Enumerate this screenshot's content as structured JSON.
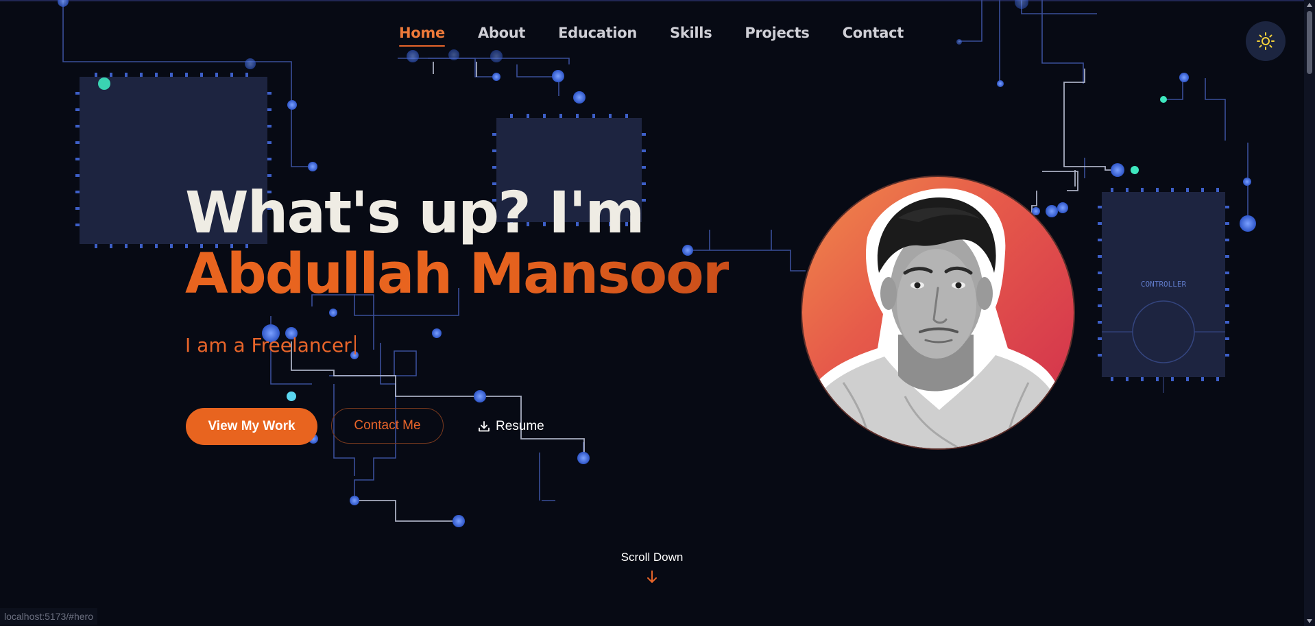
{
  "nav": {
    "items": [
      {
        "label": "Home",
        "active": true
      },
      {
        "label": "About"
      },
      {
        "label": "Education"
      },
      {
        "label": "Skills"
      },
      {
        "label": "Projects"
      },
      {
        "label": "Contact"
      }
    ]
  },
  "theme_toggle": {
    "icon": "sun-icon",
    "color": "#f5d23a"
  },
  "hero": {
    "greeting": "What's up? I'm",
    "name": "Abdullah Mansoor",
    "tagline": "I am a Freelancer",
    "buttons": {
      "primary": "View My Work",
      "secondary": "Contact Me",
      "resume": "Resume"
    }
  },
  "circuit": {
    "chip_label": "CONTROLLER"
  },
  "scroll_hint": "Scroll Down",
  "status_url": "localhost:5173/#hero",
  "colors": {
    "accent": "#e8641f",
    "background": "#070a14",
    "circuit": "#3a5fcf",
    "led": "#2ee6a6"
  }
}
